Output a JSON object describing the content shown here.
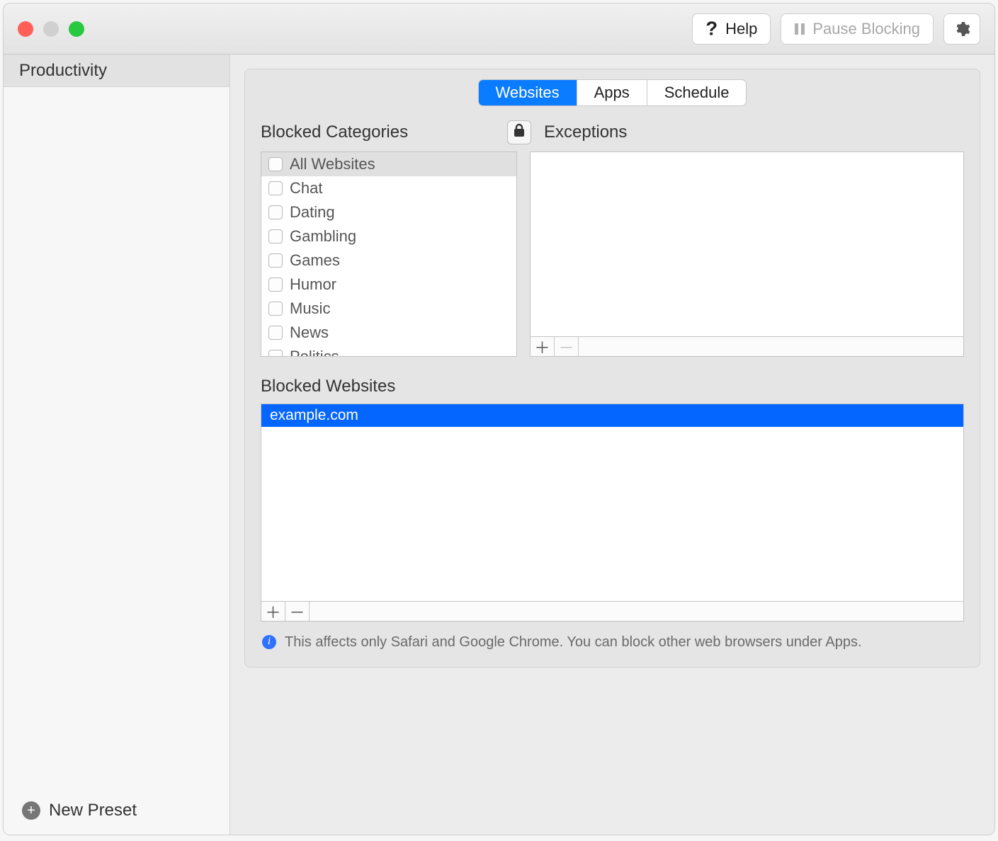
{
  "traffic_lights": {
    "close": "close",
    "minimize": "minimize",
    "zoom": "zoom"
  },
  "toolbar": {
    "help_label": "Help",
    "pause_label": "Pause Blocking"
  },
  "sidebar": {
    "presets": [
      {
        "label": "Productivity",
        "selected": true
      }
    ],
    "new_preset_label": "New Preset"
  },
  "tabs": {
    "websites": "Websites",
    "apps": "Apps",
    "schedule": "Schedule",
    "active": "websites"
  },
  "labels": {
    "blocked_categories": "Blocked Categories",
    "exceptions": "Exceptions",
    "blocked_websites": "Blocked Websites"
  },
  "categories": [
    {
      "label": "All Websites",
      "checked": false,
      "selected": true
    },
    {
      "label": "Chat",
      "checked": false,
      "selected": false
    },
    {
      "label": "Dating",
      "checked": false,
      "selected": false
    },
    {
      "label": "Gambling",
      "checked": false,
      "selected": false
    },
    {
      "label": "Games",
      "checked": false,
      "selected": false
    },
    {
      "label": "Humor",
      "checked": false,
      "selected": false
    },
    {
      "label": "Music",
      "checked": false,
      "selected": false
    },
    {
      "label": "News",
      "checked": false,
      "selected": false
    },
    {
      "label": "Politics",
      "checked": false,
      "selected": false
    }
  ],
  "exceptions": [],
  "blocked_sites": [
    {
      "url": "example.com",
      "selected": true
    }
  ],
  "info_note": "This affects only Safari and Google Chrome. You can block other web browsers under Apps."
}
